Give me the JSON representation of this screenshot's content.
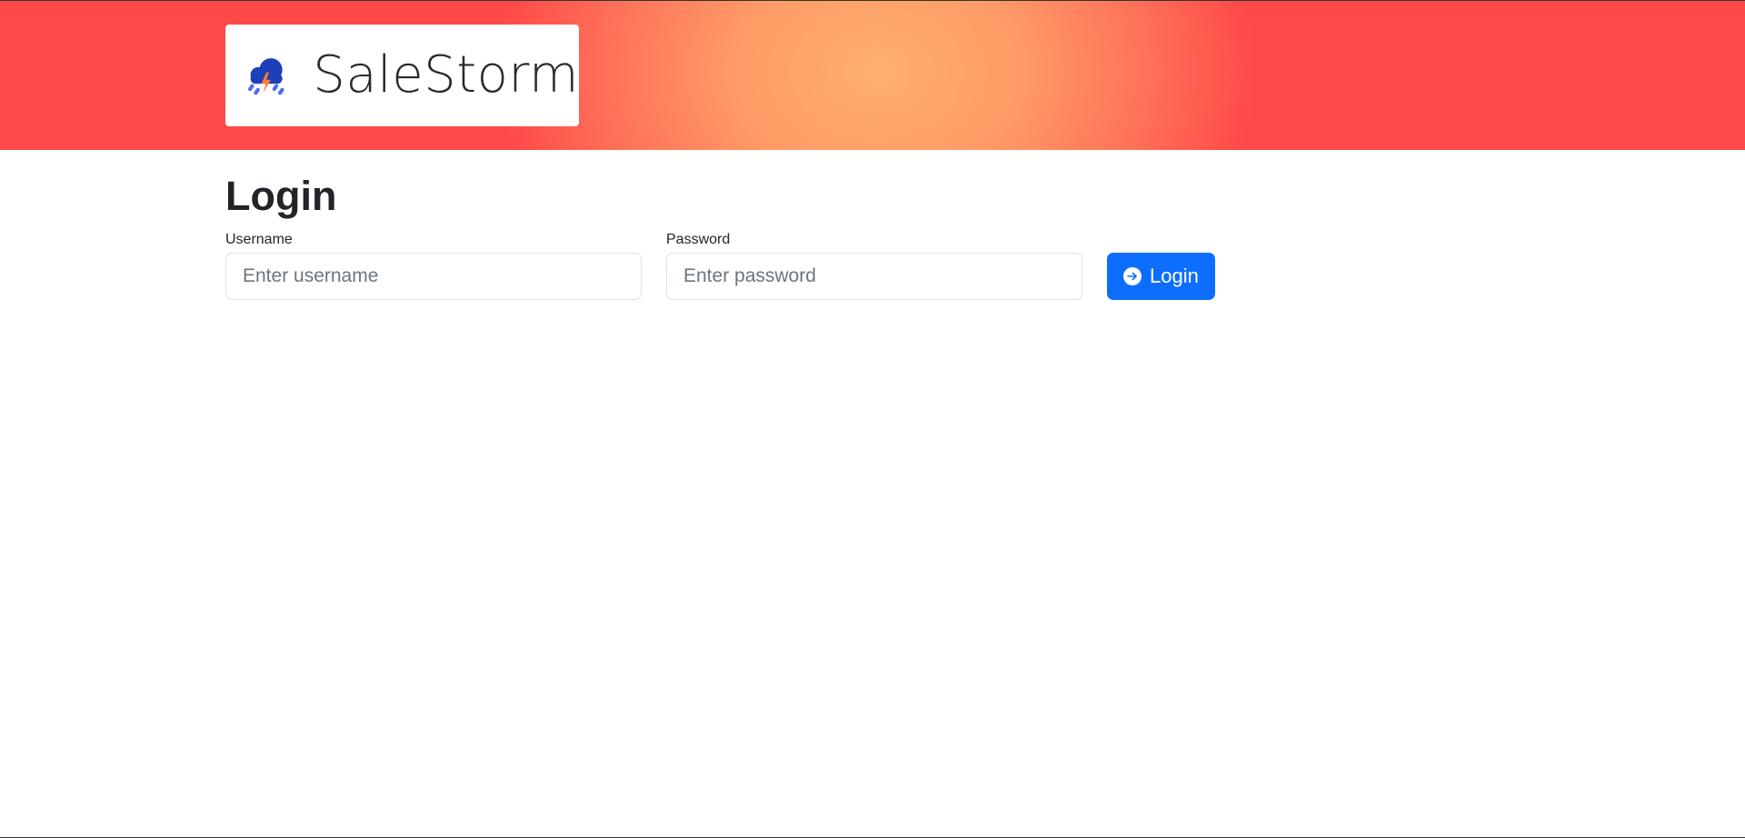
{
  "brand": {
    "name": "SaleStorm",
    "icon": "storm-cloud-icon"
  },
  "login": {
    "title": "Login",
    "username": {
      "label": "Username",
      "placeholder": "Enter username",
      "value": ""
    },
    "password": {
      "label": "Password",
      "placeholder": "Enter password",
      "value": ""
    },
    "submit": {
      "label": "Login",
      "icon": "arrow-right-circle-icon"
    }
  },
  "colors": {
    "accent": "#0d6efd",
    "banner_center": "#ffb06e",
    "banner_edge": "#ff4848",
    "logo_cloud": "#1d3fb8",
    "logo_rain": "#4f6bf5",
    "logo_bolt": "#ff7a2e"
  }
}
